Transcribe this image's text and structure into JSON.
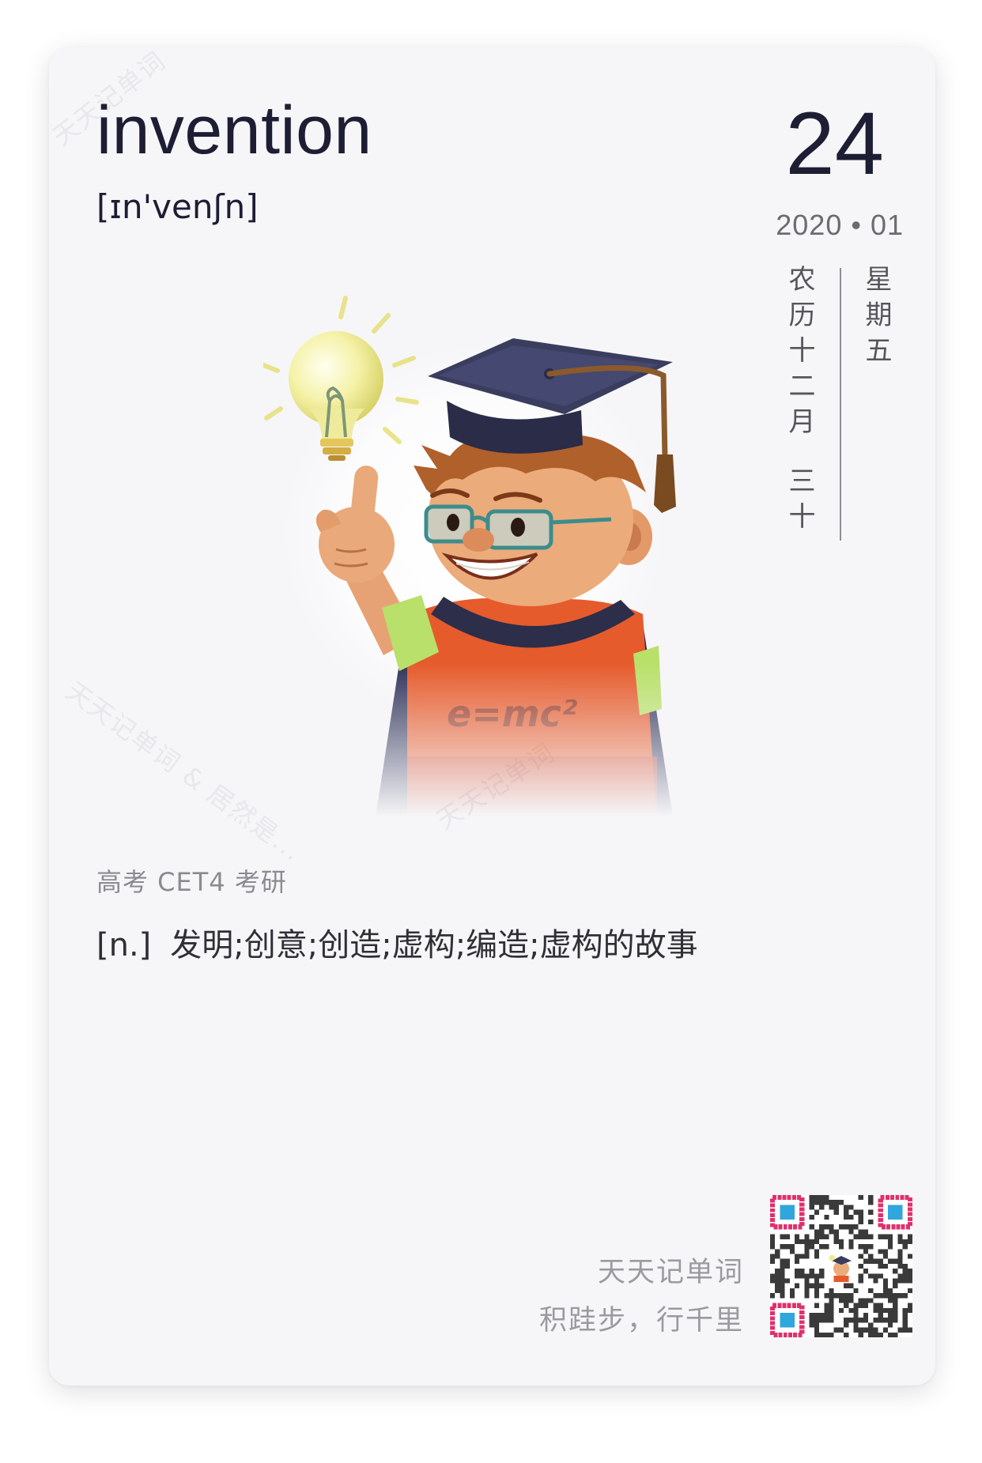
{
  "word": "invention",
  "phonetic": "[ɪn'venʃn]",
  "date": {
    "day": "24",
    "year_month": "2020 • 01",
    "lunar_month": "农历十二月",
    "lunar_day": "三十",
    "weekday": "星期五"
  },
  "illustration": {
    "subject": "scholar-boy-with-lightbulb",
    "shirt_text": "e=mc²"
  },
  "tags": "高考 CET4 考研",
  "definition": {
    "pos": "[n.]",
    "meaning": "发明;创意;创造;虚构;编造;虚构的故事"
  },
  "footer": {
    "app_name": "天天记单词",
    "slogan": "积跬步，行千里"
  },
  "qr_code": {
    "icon": "qr-code-icon"
  },
  "watermarks": [
    "天天记单词",
    "天天记单词 & 居然是...",
    "天天记单词"
  ],
  "colors": {
    "card_background": "#f6f6f8",
    "title_text": "#1d1e33",
    "muted_text": "#9a9aa1",
    "qr_finder_outer": "#e0306c",
    "qr_finder_inner": "#2fa6dc",
    "shirt": "#e55b2c",
    "cap": "#3a3d5e"
  }
}
